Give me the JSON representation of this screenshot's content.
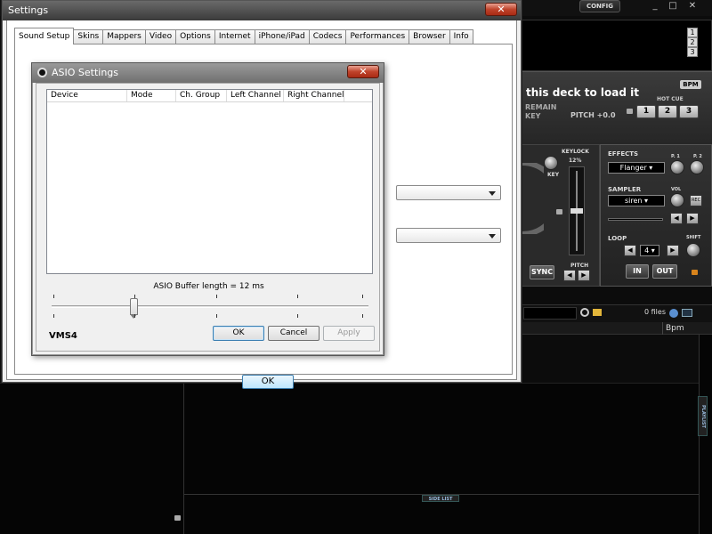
{
  "dj_app": {
    "config_label": "CONFIG",
    "window_controls": [
      "_",
      "□",
      "✕"
    ],
    "deck_selector": [
      "1",
      "2",
      "3"
    ],
    "deck_message": "this deck to load it",
    "remain_label": "REMAIN",
    "key_label": "KEY",
    "pitch_label": "PITCH +0.0",
    "bpm_label": "BPM",
    "hot_cue_label": "HOT CUE",
    "hot_cues": [
      "1",
      "2",
      "3"
    ],
    "keylock_label": "KEYLOCK",
    "keylock_value": "12%",
    "key_knob_label": "KEY",
    "sync_label": "SYNC",
    "pitch_bottom_label": "PITCH",
    "effects_label": "EFFECTS",
    "effect_selected": "Flanger",
    "p1_label": "P. 1",
    "p2_label": "P. 2",
    "sampler_label": "SAMPLER",
    "sampler_selected": "siren",
    "vol_label": "VOL",
    "rec_label": "REC",
    "loop_label": "LOOP",
    "loop_value": "4",
    "shift_label": "SHIFT",
    "loop_in": "IN",
    "loop_out": "OUT",
    "files_count": "0 files",
    "bpm_column": "Bpm",
    "side_list_tab": "SIDE LIST",
    "playlist_tab": "PLAYLIST",
    "colors": {
      "dark_bg": "#0c0c0c",
      "panel": "#2a2a2a"
    }
  },
  "settings": {
    "title": "Settings",
    "close_label": "✕",
    "tabs": [
      {
        "label": "Sound Setup",
        "active": true
      },
      {
        "label": "Skins",
        "active": false
      },
      {
        "label": "Mappers",
        "active": false
      },
      {
        "label": "Video",
        "active": false
      },
      {
        "label": "Options",
        "active": false
      },
      {
        "label": "Internet",
        "active": false
      },
      {
        "label": "iPhone/iPad",
        "active": false
      },
      {
        "label": "Codecs",
        "active": false
      },
      {
        "label": "Performances",
        "active": false
      },
      {
        "label": "Browser",
        "active": false
      },
      {
        "label": "Info",
        "active": false
      }
    ],
    "partial_label": "S",
    "ok_label": "OK"
  },
  "asio_dialog": {
    "title": "ASIO Settings",
    "close_label": "✕",
    "columns": [
      "Device",
      "Mode",
      "Ch. Group",
      "Left Channel",
      "Right Channel"
    ],
    "buffer_label": "ASIO Buffer length = 12 ms",
    "slider_position": 0.26,
    "vm_label": "VMS4",
    "ok_label": "OK",
    "cancel_label": "Cancel",
    "apply_label": "Apply"
  }
}
